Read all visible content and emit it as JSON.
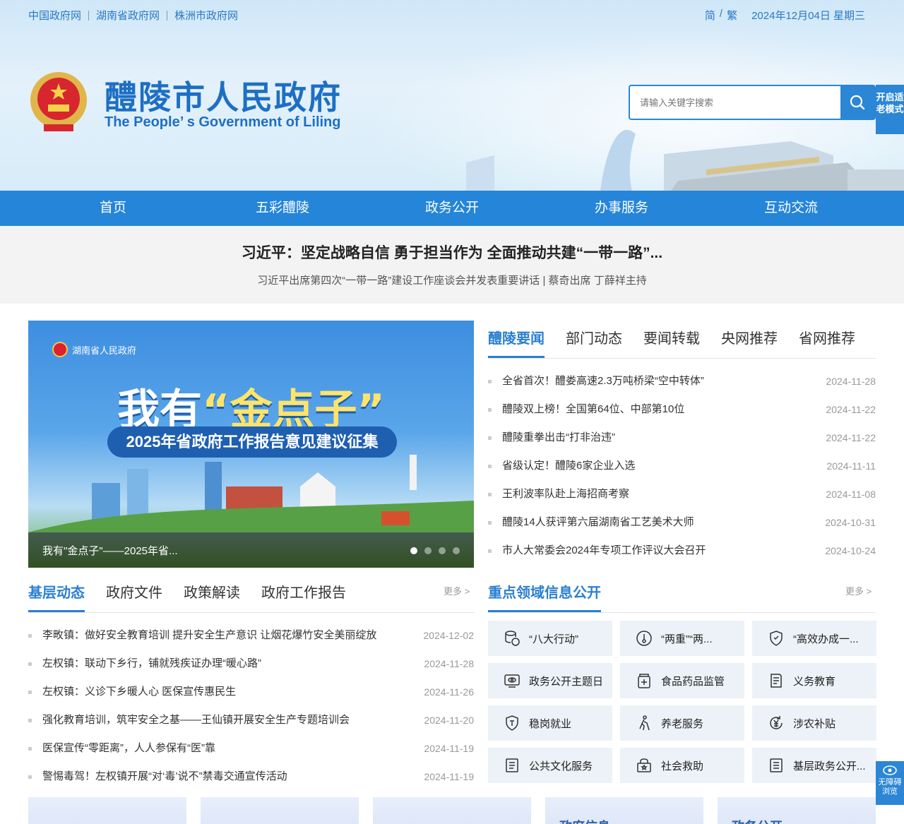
{
  "top_links": [
    "中国政府网",
    "湖南省政府网",
    "株洲市政府网"
  ],
  "top_right": {
    "simplified": "简",
    "slash": "/",
    "traditional": "繁",
    "date": "2024年12月04日 星期三"
  },
  "site": {
    "title": "醴陵市人民政府",
    "subtitle": "The People’ s Government of Liling"
  },
  "search": {
    "placeholder": "请输入关键字搜索"
  },
  "elder_mode": "开启适老模式",
  "nav": [
    "首页",
    "五彩醴陵",
    "政务公开",
    "办事服务",
    "互动交流"
  ],
  "headline": {
    "title": "习近平：坚定战略自信 勇于担当作为 全面推动共建“一带一路”...",
    "subtitle": "习近平出席第四次“一带一路”建设工作座谈会并发表重要讲话 | 蔡奇出席 丁薛祥主持"
  },
  "slider": {
    "org": "湖南省人民政府",
    "big_prefix": "我有",
    "big_highlight": "“金点子”",
    "ribbon": "2025年省政府工作报告意见建议征集",
    "caption": "我有\"金点子\"——2025年省...",
    "dots": 4
  },
  "news_tabs": [
    "醴陵要闻",
    "部门动态",
    "要闻转载",
    "央网推荐",
    "省网推荐"
  ],
  "news": [
    {
      "title": "全省首次！醴娄高速2.3万吨桥梁“空中转体”",
      "date": "2024-11-28"
    },
    {
      "title": "醴陵双上榜！全国第64位、中部第10位",
      "date": "2024-11-22"
    },
    {
      "title": "醴陵重拳出击“打非治违”",
      "date": "2024-11-22"
    },
    {
      "title": "省级认定！醴陵6家企业入选",
      "date": "2024-11-11"
    },
    {
      "title": "王利波率队赴上海招商考察",
      "date": "2024-11-08"
    },
    {
      "title": "醴陵14人获评第六届湖南省工艺美术大师",
      "date": "2024-10-31"
    },
    {
      "title": "市人大常委会2024年专项工作评议大会召开",
      "date": "2024-10-24"
    }
  ],
  "local_tabs": [
    "基层动态",
    "政府文件",
    "政策解读",
    "政府工作报告"
  ],
  "more_label": "更多 >",
  "local_news": [
    {
      "title": "李畋镇：做好安全教育培训 提升安全生产意识 让烟花爆竹安全美丽绽放",
      "date": "2024-12-02"
    },
    {
      "title": "左权镇：联动下乡行，铺就残疾证办理“暖心路”",
      "date": "2024-11-28"
    },
    {
      "title": "左权镇：义诊下乡暖人心 医保宣传惠民生",
      "date": "2024-11-26"
    },
    {
      "title": "强化教育培训，筑牢安全之基——王仙镇开展安全生产专题培训会",
      "date": "2024-11-20"
    },
    {
      "title": "医保宣传“零距离”，人人参保有“医”靠",
      "date": "2024-11-19"
    },
    {
      "title": "警惕毒驾！左权镇开展“对‘毒’说不”禁毒交通宣传活动",
      "date": "2024-11-19"
    }
  ],
  "key_tabs": [
    "重点领域信息公开"
  ],
  "key_items": [
    {
      "label": "“八大行动”",
      "icon": "coins-icon"
    },
    {
      "label": "“两重”“两...",
      "icon": "thermometer-icon"
    },
    {
      "label": "“高效办成一...",
      "icon": "shield-badge-icon"
    },
    {
      "label": "政务公开主题日",
      "icon": "eye-icon"
    },
    {
      "label": "食品药品监管",
      "icon": "medicine-icon"
    },
    {
      "label": "义务教育",
      "icon": "book-icon"
    },
    {
      "label": "稳岗就业",
      "icon": "shield-guarantee-icon"
    },
    {
      "label": "养老服务",
      "icon": "walking-elder-icon"
    },
    {
      "label": "涉农补贴",
      "icon": "yuan-cycle-icon"
    },
    {
      "label": "公共文化服务",
      "icon": "document-icon"
    },
    {
      "label": "社会救助",
      "icon": "relief-box-icon"
    },
    {
      "label": "基层政务公开...",
      "icon": "document-list-icon"
    }
  ],
  "cards": [
    "",
    "",
    "",
    "政府信息",
    "政务公开"
  ],
  "accessibility": "无障碍浏览",
  "colors": {
    "primary": "#2585d9",
    "title": "#1d6fc4",
    "accent": "#2b7fd0"
  }
}
